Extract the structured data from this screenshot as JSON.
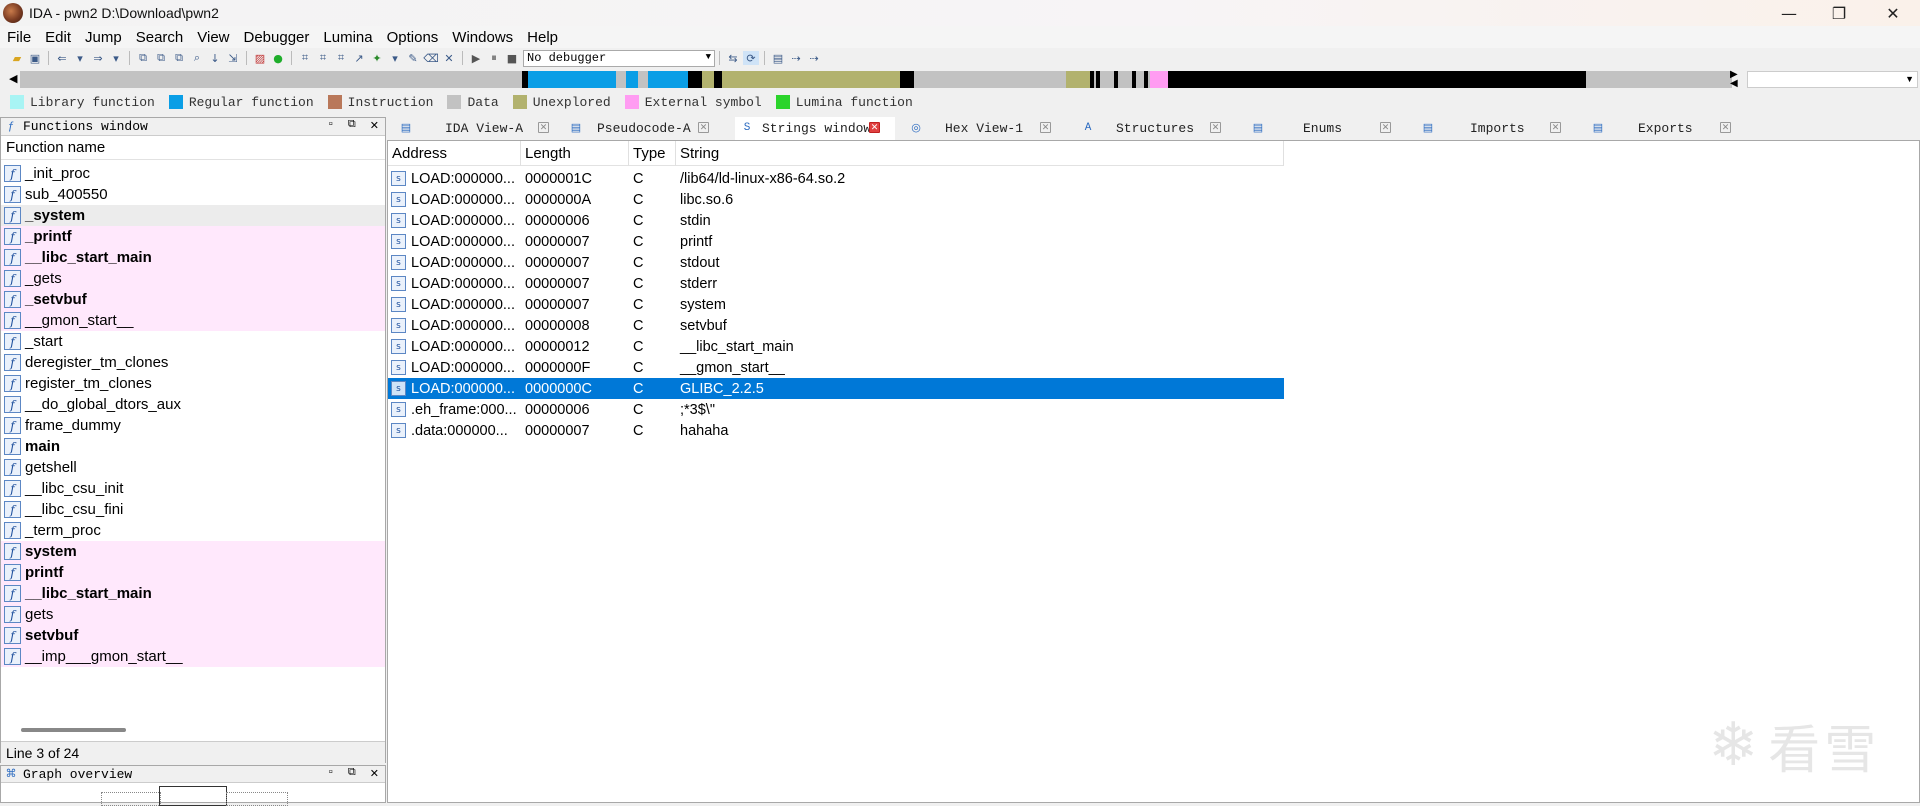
{
  "window": {
    "title": "IDA - pwn2 D:\\Download\\pwn2",
    "minimize": "—",
    "restore": "❐",
    "close": "✕"
  },
  "menu": [
    "File",
    "Edit",
    "Jump",
    "Search",
    "View",
    "Debugger",
    "Lumina",
    "Options",
    "Windows",
    "Help"
  ],
  "toolbar": {
    "debugger_select": "No debugger"
  },
  "legend": [
    {
      "label": "Library function",
      "color": "#a8f4f4"
    },
    {
      "label": "Regular function",
      "color": "#0a9ee6"
    },
    {
      "label": "Instruction",
      "color": "#b9785a"
    },
    {
      "label": "Data",
      "color": "#c2c2c2"
    },
    {
      "label": "Unexplored",
      "color": "#b2b26e"
    },
    {
      "label": "External symbol",
      "color": "#ff9cf2"
    },
    {
      "label": "Lumina function",
      "color": "#2bd42b"
    }
  ],
  "functions_window": {
    "title": "Functions window",
    "column_header": "Function name",
    "status": "Line 3 of 24",
    "items": [
      {
        "name": "_init_proc",
        "bold": false,
        "lib": false,
        "selected": false
      },
      {
        "name": "sub_400550",
        "bold": false,
        "lib": false,
        "selected": false
      },
      {
        "name": "_system",
        "bold": true,
        "lib": false,
        "selected": true
      },
      {
        "name": "_printf",
        "bold": true,
        "lib": true,
        "selected": false
      },
      {
        "name": "__libc_start_main",
        "bold": true,
        "lib": true,
        "selected": false
      },
      {
        "name": "_gets",
        "bold": false,
        "lib": true,
        "selected": false
      },
      {
        "name": "_setvbuf",
        "bold": true,
        "lib": true,
        "selected": false
      },
      {
        "name": "__gmon_start__",
        "bold": false,
        "lib": true,
        "selected": false
      },
      {
        "name": "_start",
        "bold": false,
        "lib": false,
        "selected": false
      },
      {
        "name": "deregister_tm_clones",
        "bold": false,
        "lib": false,
        "selected": false
      },
      {
        "name": "register_tm_clones",
        "bold": false,
        "lib": false,
        "selected": false
      },
      {
        "name": "__do_global_dtors_aux",
        "bold": false,
        "lib": false,
        "selected": false
      },
      {
        "name": "frame_dummy",
        "bold": false,
        "lib": false,
        "selected": false
      },
      {
        "name": "main",
        "bold": true,
        "lib": false,
        "selected": false
      },
      {
        "name": "getshell",
        "bold": false,
        "lib": false,
        "selected": false
      },
      {
        "name": "__libc_csu_init",
        "bold": false,
        "lib": false,
        "selected": false
      },
      {
        "name": "__libc_csu_fini",
        "bold": false,
        "lib": false,
        "selected": false
      },
      {
        "name": "_term_proc",
        "bold": false,
        "lib": false,
        "selected": false
      },
      {
        "name": "system",
        "bold": true,
        "lib": true,
        "selected": false
      },
      {
        "name": "printf",
        "bold": true,
        "lib": true,
        "selected": false
      },
      {
        "name": "__libc_start_main",
        "bold": true,
        "lib": true,
        "selected": false
      },
      {
        "name": "gets",
        "bold": false,
        "lib": true,
        "selected": false
      },
      {
        "name": "setvbuf",
        "bold": true,
        "lib": true,
        "selected": false
      },
      {
        "name": "__imp___gmon_start__",
        "bold": false,
        "lib": true,
        "selected": false
      }
    ]
  },
  "graph_overview": {
    "title": "Graph overview"
  },
  "tabs": [
    {
      "label": "IDA View-A",
      "active": false
    },
    {
      "label": "Pseudocode-A",
      "active": false
    },
    {
      "label": "Strings window",
      "active": true
    },
    {
      "label": "Hex View-1",
      "active": false
    },
    {
      "label": "Structures",
      "active": false
    },
    {
      "label": "Enums",
      "active": false
    },
    {
      "label": "Imports",
      "active": false
    },
    {
      "label": "Exports",
      "active": false
    }
  ],
  "strings_window": {
    "columns": [
      "Address",
      "Length",
      "Type",
      "String"
    ],
    "rows": [
      {
        "address": "LOAD:000000...",
        "length": "0000001C",
        "type": "C",
        "string": "/lib64/ld-linux-x86-64.so.2",
        "selected": false
      },
      {
        "address": "LOAD:000000...",
        "length": "0000000A",
        "type": "C",
        "string": "libc.so.6",
        "selected": false
      },
      {
        "address": "LOAD:000000...",
        "length": "00000006",
        "type": "C",
        "string": "stdin",
        "selected": false
      },
      {
        "address": "LOAD:000000...",
        "length": "00000007",
        "type": "C",
        "string": "printf",
        "selected": false
      },
      {
        "address": "LOAD:000000...",
        "length": "00000007",
        "type": "C",
        "string": "stdout",
        "selected": false
      },
      {
        "address": "LOAD:000000...",
        "length": "00000007",
        "type": "C",
        "string": "stderr",
        "selected": false
      },
      {
        "address": "LOAD:000000...",
        "length": "00000007",
        "type": "C",
        "string": "system",
        "selected": false
      },
      {
        "address": "LOAD:000000...",
        "length": "00000008",
        "type": "C",
        "string": "setvbuf",
        "selected": false
      },
      {
        "address": "LOAD:000000...",
        "length": "00000012",
        "type": "C",
        "string": "__libc_start_main",
        "selected": false
      },
      {
        "address": "LOAD:000000...",
        "length": "0000000F",
        "type": "C",
        "string": "__gmon_start__",
        "selected": false
      },
      {
        "address": "LOAD:000000...",
        "length": "0000000C",
        "type": "C",
        "string": "GLIBC_2.2.5",
        "selected": true
      },
      {
        "address": ".eh_frame:000...",
        "length": "00000006",
        "type": "C",
        "string": ";*3$\\\"",
        "selected": false
      },
      {
        "address": ".data:000000...",
        "length": "00000007",
        "type": "C",
        "string": "hahaha",
        "selected": false
      }
    ]
  },
  "watermark": {
    "text": "看雪"
  }
}
